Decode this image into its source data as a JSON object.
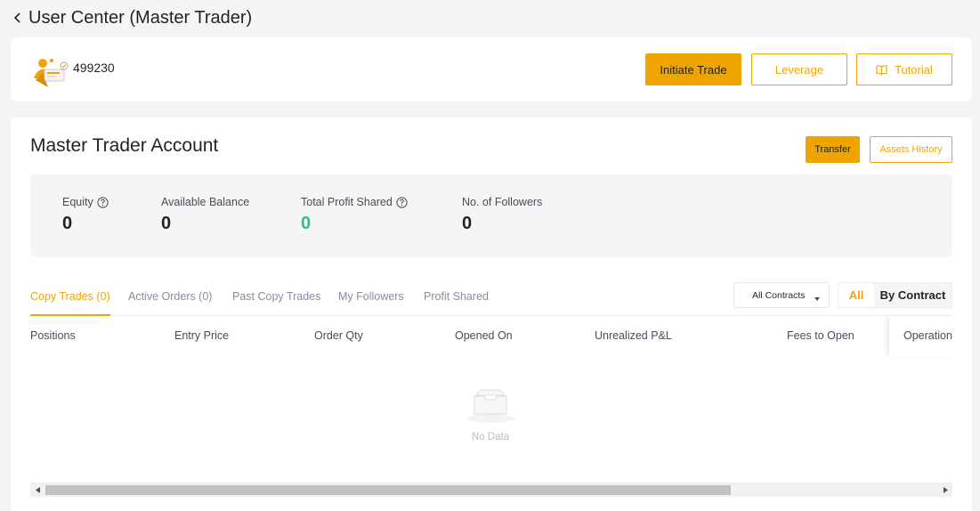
{
  "header": {
    "title": "User Center (Master Trader)"
  },
  "profile": {
    "uid": "499230",
    "buttons": {
      "initiate": "Initiate Trade",
      "leverage": "Leverage",
      "tutorial": "Tutorial"
    }
  },
  "account": {
    "title": "Master Trader Account",
    "transfer_label": "Transfer",
    "history_label": "Assets History",
    "stats": {
      "equity": {
        "label": "Equity",
        "value": "0"
      },
      "available": {
        "label": "Available Balance",
        "value": "0"
      },
      "profit_shared": {
        "label": "Total Profit Shared",
        "value": "0"
      },
      "followers": {
        "label": "No. of Followers",
        "value": "0"
      }
    }
  },
  "tabs": [
    "Copy Trades (0)",
    "Active Orders (0)",
    "Past Copy Trades",
    "My Followers",
    "Profit Shared"
  ],
  "filters": {
    "contracts": "All Contracts",
    "all": "All",
    "by_contract": "By Contract"
  },
  "table": {
    "columns": [
      "Positions",
      "Entry Price",
      "Order Qty",
      "Opened On",
      "Unrealized P&L",
      "Fees to Open",
      "Operation"
    ],
    "empty_text": "No Data"
  },
  "colors": {
    "accent": "#f0a400",
    "profit": "#2ebd85"
  }
}
